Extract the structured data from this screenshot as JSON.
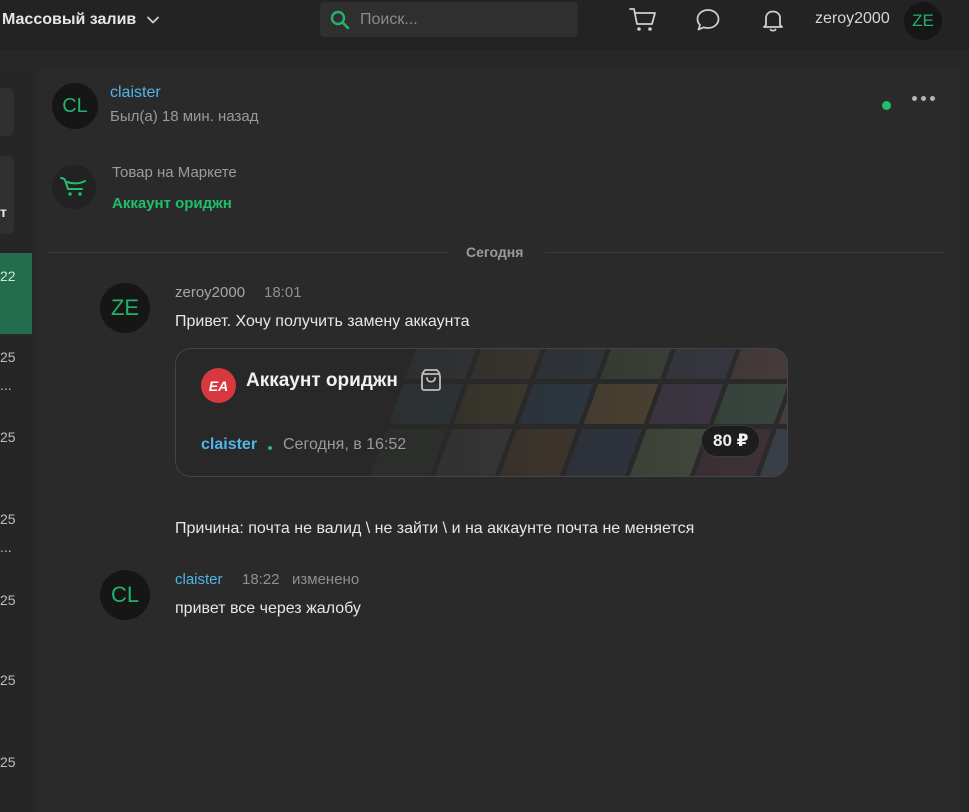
{
  "topbar": {
    "menu_title": "Массовый залив",
    "search_placeholder": "Поиск...",
    "username": "zeroy2000",
    "avatar_initials": "ZE"
  },
  "sidebar": {
    "active_text": "т",
    "row_texts": [
      "22",
      "25",
      "...",
      "25",
      "25",
      "...",
      "25",
      "25",
      "25"
    ]
  },
  "chat": {
    "peer_name": "claister",
    "peer_initials": "CL",
    "peer_status": "Был(а) 18 мин. назад",
    "market_label": "Товар на Маркете",
    "market_link": "Аккаунт ориджн",
    "day_separator": "Сегодня"
  },
  "messages": [
    {
      "author": "zeroy2000",
      "initials": "ZE",
      "time": "18:01",
      "text": "Привет. Хочу получить замену аккаунта",
      "extra_text": "Причина: почта не валид \\ не зайти \\ и на аккаунте почта не меняется"
    },
    {
      "author": "claister",
      "initials": "CL",
      "time": "18:22",
      "edited": "изменено",
      "text": "привет все через жалобу"
    }
  ],
  "product_card": {
    "logo_text": "EA",
    "title": "Аккаунт ориджн",
    "seller": "claister",
    "date": "Сегодня, в 16:52",
    "price": "80 ₽"
  },
  "colors": {
    "accent_green": "#1fbf6b",
    "link_blue": "#4fb6e8",
    "ea_red": "#d7393e",
    "background": "#272727"
  },
  "icons": [
    "chevron-down-icon",
    "search-icon",
    "cart-icon",
    "chat-icon",
    "bell-icon",
    "market-cart-icon",
    "more-icon",
    "bag-icon"
  ]
}
